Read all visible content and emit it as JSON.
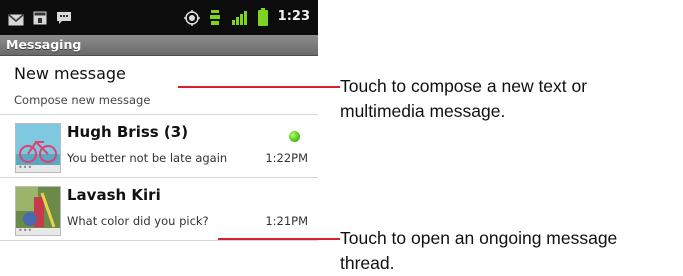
{
  "status_bar": {
    "time": "1:23",
    "icons": [
      "gmail-icon",
      "calendar-icon",
      "sms-icon",
      "gps-icon",
      "network-3g-icon",
      "signal-icon",
      "battery-icon"
    ]
  },
  "app": {
    "title": "Messaging"
  },
  "new_message": {
    "label": "New message",
    "subtitle": "Compose new message"
  },
  "threads": [
    {
      "name": "Hugh Briss (3)",
      "snippet": "You better not be late again",
      "time": "1:22PM",
      "online": true
    },
    {
      "name": "Lavash Kiri",
      "snippet": "What color did you pick?",
      "time": "1:21PM",
      "online": false
    }
  ],
  "callouts": [
    {
      "line1": "Touch to compose a new text or",
      "line2": "multimedia message."
    },
    {
      "line1": "Touch to open an ongoing message",
      "line2": "thread."
    }
  ],
  "colors": {
    "callout_line": "#d6202e",
    "presence": "#4cc61a",
    "title_bar": "#7b7b7b",
    "status_bar": "#0c0c0c"
  }
}
